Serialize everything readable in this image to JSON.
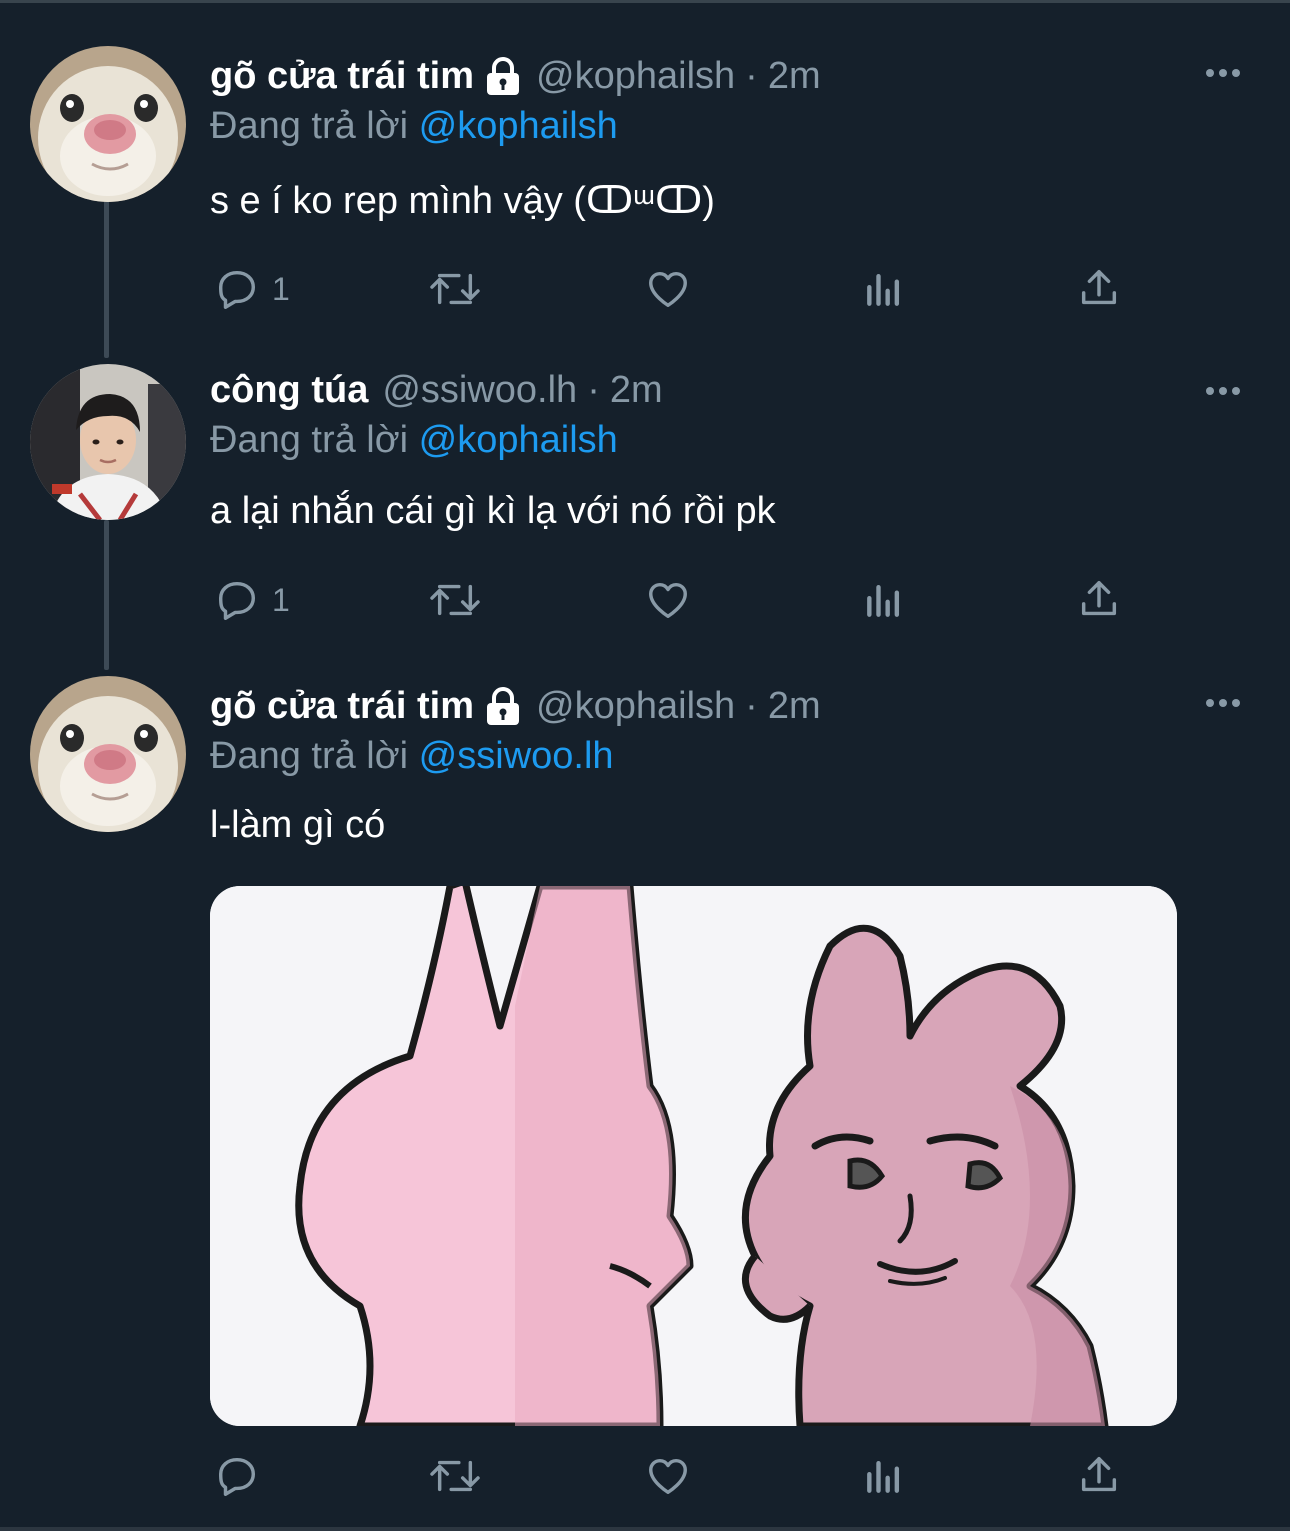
{
  "tweets": [
    {
      "name": "gõ cửa trái tim",
      "handle": "@kophailsh",
      "dot": "·",
      "time": "2m",
      "reply_prefix": "Đang trả lời",
      "reply_to": "@kophailsh",
      "text": "s e í ko rep mình vậy (ↀᵚↀ)",
      "replies": "1",
      "locked": true,
      "avatar": "hamster-avatar"
    },
    {
      "name": "công túa",
      "handle": "@ssiwoo.lh",
      "dot": "·",
      "time": "2m",
      "reply_prefix": "Đang trả lời",
      "reply_to": "@kophailsh",
      "text": "a lại nhắn cái gì kì lạ với nó rồi pk",
      "replies": "1",
      "locked": false,
      "avatar": "person-avatar"
    },
    {
      "name": "gõ cửa trái tim",
      "handle": "@kophailsh",
      "dot": "·",
      "time": "2m",
      "reply_prefix": "Đang trả lời",
      "reply_to": "@ssiwoo.lh",
      "text": "l-làm gì có",
      "replies": "",
      "locked": true,
      "avatar": "hamster-avatar",
      "media": "pink-bunny-sticker"
    }
  ],
  "icons": {
    "reply": "reply-icon",
    "retweet": "retweet-icon",
    "like": "heart-icon",
    "analytics": "analytics-icon",
    "share": "share-icon",
    "more": "more-icon",
    "lock": "lock-icon"
  },
  "colors": {
    "background": "#15202b",
    "muted": "#8899a6",
    "link": "#1d9bf0",
    "thread_line": "#3d4a56"
  }
}
